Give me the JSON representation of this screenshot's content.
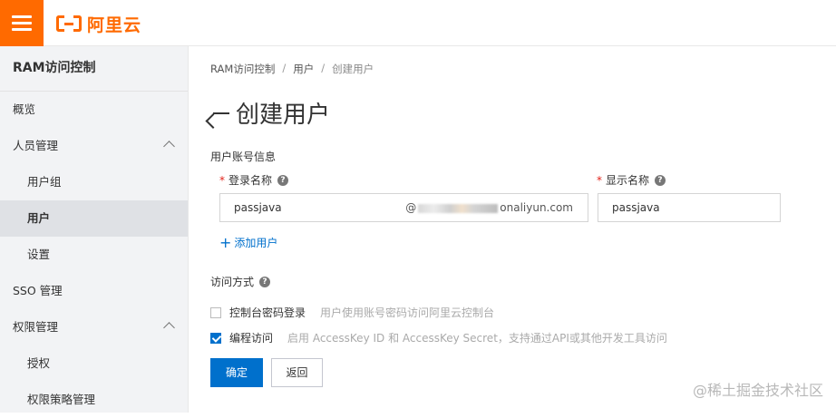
{
  "brand": {
    "logo_text": "阿里云",
    "accent_color": "#ff6a00"
  },
  "sidebar": {
    "title": "RAM访问控制",
    "items": [
      {
        "label": "概览",
        "level": 0
      },
      {
        "label": "人员管理",
        "level": 0,
        "expanded": true
      },
      {
        "label": "用户组",
        "level": 1
      },
      {
        "label": "用户",
        "level": 1,
        "active": true
      },
      {
        "label": "设置",
        "level": 1
      },
      {
        "label": "SSO 管理",
        "level": 0
      },
      {
        "label": "权限管理",
        "level": 0,
        "expanded": true
      },
      {
        "label": "授权",
        "level": 1
      },
      {
        "label": "权限策略管理",
        "level": 1
      }
    ]
  },
  "breadcrumb": [
    "RAM访问控制",
    "用户",
    "创建用户"
  ],
  "breadcrumb_separator": "/",
  "page": {
    "title": "创建用户"
  },
  "user_info": {
    "section_label": "用户账号信息",
    "login_name_label": "登录名称",
    "login_name_value": "passjava",
    "login_domain_prefix": "@",
    "login_domain_suffix": "onaliyun.com",
    "display_name_label": "显示名称",
    "display_name_value": "passjava",
    "required_mark": "*",
    "help_glyph": "?",
    "add_user_label": "添加用户",
    "add_user_glyph": "+"
  },
  "access": {
    "label": "访问方式",
    "options": [
      {
        "label": "控制台密码登录",
        "desc": "用户使用账号密码访问阿里云控制台",
        "checked": false
      },
      {
        "label": "编程访问",
        "desc": "启用 AccessKey ID 和 AccessKey Secret，支持通过API或其他开发工具访问",
        "checked": true
      }
    ]
  },
  "actions": {
    "confirm": "确定",
    "back": "返回"
  },
  "watermark": "@稀土掘金技术社区",
  "colors": {
    "primary": "#0070cc",
    "required": "#e2231a"
  }
}
